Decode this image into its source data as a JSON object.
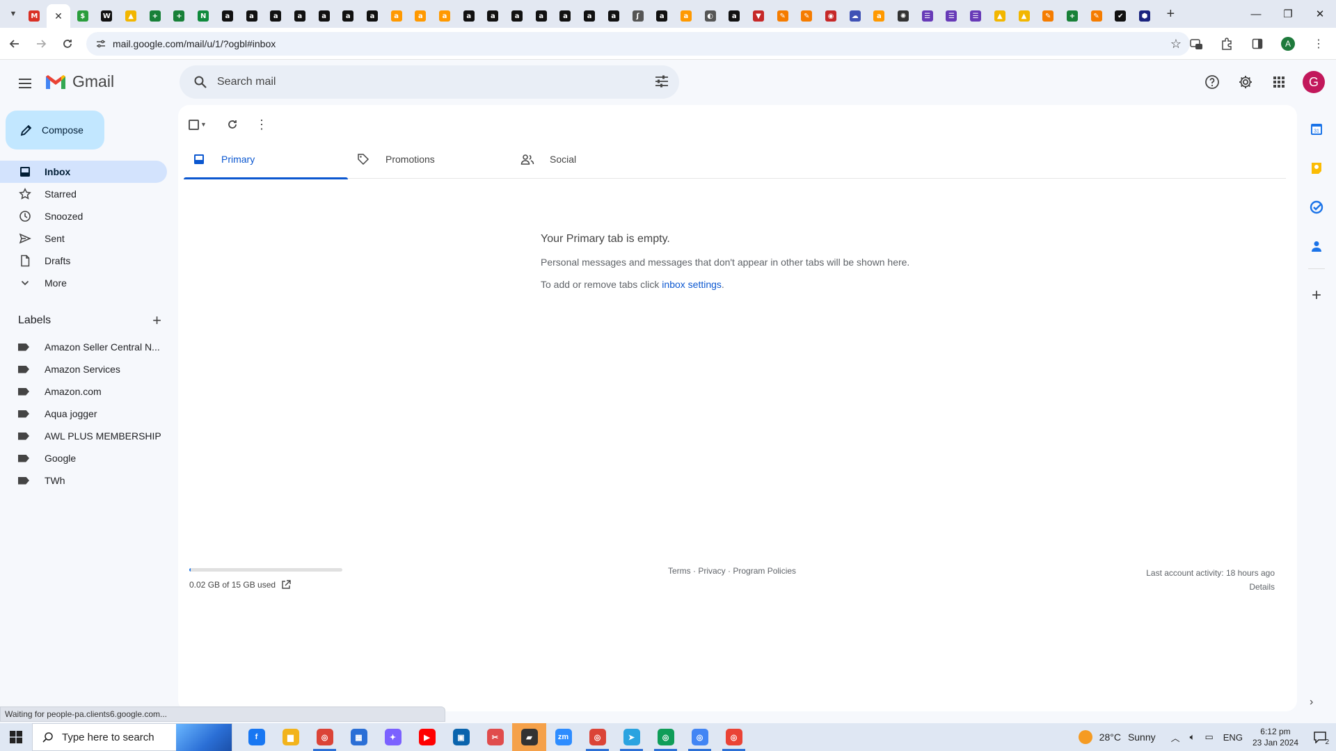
{
  "browser": {
    "tabs": [
      {
        "icon": "gmail-icon",
        "color": "#d93025",
        "glyph": "M"
      },
      {
        "icon": "close-icon",
        "color": "#333333",
        "glyph": "✕",
        "active": true
      },
      {
        "icon": "currency-icon",
        "color": "#2a9d3c",
        "glyph": "$"
      },
      {
        "icon": "wix-icon",
        "color": "#111111",
        "glyph": "W"
      },
      {
        "icon": "google-drive-icon",
        "color": "#f2b600",
        "glyph": "▲"
      },
      {
        "icon": "google-sheets-icon",
        "color": "#188038",
        "glyph": "+"
      },
      {
        "icon": "google-sheets-icon",
        "color": "#188038",
        "glyph": "+"
      },
      {
        "icon": "script-icon",
        "color": "#0f8a3c",
        "glyph": "N"
      },
      {
        "icon": "amazon-a-icon",
        "color": "#111111",
        "glyph": "a"
      },
      {
        "icon": "amazon-a-icon",
        "color": "#111111",
        "glyph": "a"
      },
      {
        "icon": "amazon-a-icon",
        "color": "#111111",
        "glyph": "a"
      },
      {
        "icon": "amazon-a-icon",
        "color": "#111111",
        "glyph": "a"
      },
      {
        "icon": "amazon-a-icon",
        "color": "#111111",
        "glyph": "a"
      },
      {
        "icon": "amazon-a-icon",
        "color": "#111111",
        "glyph": "a"
      },
      {
        "icon": "amazon-a-icon",
        "color": "#111111",
        "glyph": "a"
      },
      {
        "icon": "amazon-smile-icon",
        "color": "#ff9900",
        "glyph": "a"
      },
      {
        "icon": "amazon-smile-icon",
        "color": "#ff9900",
        "glyph": "a"
      },
      {
        "icon": "amazon-smile-icon",
        "color": "#ff9900",
        "glyph": "a"
      },
      {
        "icon": "amazon-a-icon",
        "color": "#111111",
        "glyph": "a"
      },
      {
        "icon": "amazon-a-icon",
        "color": "#111111",
        "glyph": "a"
      },
      {
        "icon": "amazon-a-icon",
        "color": "#111111",
        "glyph": "a"
      },
      {
        "icon": "amazon-a-icon",
        "color": "#111111",
        "glyph": "a"
      },
      {
        "icon": "amazon-a-icon",
        "color": "#111111",
        "glyph": "a"
      },
      {
        "icon": "amazon-a-icon",
        "color": "#111111",
        "glyph": "a"
      },
      {
        "icon": "amazon-a-icon",
        "color": "#111111",
        "glyph": "a"
      },
      {
        "icon": "hook-icon",
        "color": "#555555",
        "glyph": "ʃ"
      },
      {
        "icon": "amazon-a-icon",
        "color": "#111111",
        "glyph": "a"
      },
      {
        "icon": "amazon-smile-icon",
        "color": "#ff9900",
        "glyph": "a"
      },
      {
        "icon": "globe-icon",
        "color": "#555555",
        "glyph": "◐"
      },
      {
        "icon": "amazon-a-icon",
        "color": "#111111",
        "glyph": "a"
      },
      {
        "icon": "shield-icon",
        "color": "#c62828",
        "glyph": "▼"
      },
      {
        "icon": "pen-icon",
        "color": "#f57c00",
        "glyph": "✎"
      },
      {
        "icon": "pen-icon",
        "color": "#f57c00",
        "glyph": "✎"
      },
      {
        "icon": "circle-badge-icon",
        "color": "#c62828",
        "glyph": "◉"
      },
      {
        "icon": "cloud-icon",
        "color": "#3f51b5",
        "glyph": "☁"
      },
      {
        "icon": "amazon-smile-icon",
        "color": "#ff9900",
        "glyph": "a"
      },
      {
        "icon": "openai-icon",
        "color": "#333333",
        "glyph": "✺"
      },
      {
        "icon": "form-icon",
        "color": "#673ab7",
        "glyph": "☰"
      },
      {
        "icon": "form-icon",
        "color": "#673ab7",
        "glyph": "☰"
      },
      {
        "icon": "form-icon",
        "color": "#673ab7",
        "glyph": "☰"
      },
      {
        "icon": "google-drive-icon",
        "color": "#f2b600",
        "glyph": "▲"
      },
      {
        "icon": "google-drive-icon",
        "color": "#f2b600",
        "glyph": "▲"
      },
      {
        "icon": "pen-icon",
        "color": "#f57c00",
        "glyph": "✎"
      },
      {
        "icon": "google-sheets-icon",
        "color": "#188038",
        "glyph": "+"
      },
      {
        "icon": "pen-icon",
        "color": "#f57c00",
        "glyph": "✎"
      },
      {
        "icon": "checkmark-app-icon",
        "color": "#111111",
        "glyph": "✔"
      },
      {
        "icon": "hexagon-icon",
        "color": "#1a237e",
        "glyph": "⬢"
      }
    ],
    "url": "mail.google.com/mail/u/1/?ogbl#inbox",
    "profile_initial": "A"
  },
  "gmail": {
    "logo_text": "Gmail",
    "search_placeholder": "Search mail",
    "avatar_initial": "G",
    "compose_label": "Compose",
    "nav": [
      {
        "label": "Inbox",
        "icon": "inbox-icon",
        "active": true
      },
      {
        "label": "Starred",
        "icon": "star-icon"
      },
      {
        "label": "Snoozed",
        "icon": "clock-icon"
      },
      {
        "label": "Sent",
        "icon": "send-icon"
      },
      {
        "label": "Drafts",
        "icon": "draft-icon"
      },
      {
        "label": "More",
        "icon": "chevron-down-icon"
      }
    ],
    "labels_title": "Labels",
    "labels": [
      "Amazon Seller Central N...",
      "Amazon Services",
      "Amazon.com",
      "Aqua jogger",
      "AWL PLUS MEMBERSHIP",
      "Google",
      "TWh"
    ],
    "category_tabs": [
      {
        "label": "Primary",
        "icon": "inbox-tab-icon",
        "active": true
      },
      {
        "label": "Promotions",
        "icon": "tag-icon"
      },
      {
        "label": "Social",
        "icon": "people-icon"
      }
    ],
    "empty_state": {
      "title": "Your Primary tab is empty.",
      "line1": "Personal messages and messages that don't appear in other tabs will be shown here.",
      "line2_prefix": "To add or remove tabs click ",
      "line2_link": "inbox settings",
      "line2_suffix": "."
    },
    "storage": {
      "text": "0.02 GB of 15 GB used",
      "used_fraction": 0.0013
    },
    "footer": {
      "terms": "Terms",
      "privacy": "Privacy",
      "policies": "Program Policies",
      "separator": " · ",
      "activity": "Last account activity: 18 hours ago",
      "details": "Details"
    },
    "side_panel": [
      "calendar-icon",
      "keep-icon",
      "tasks-icon",
      "contacts-icon",
      "add-icon"
    ]
  },
  "status_text": "Waiting for people-pa.clients6.google.com...",
  "taskbar": {
    "search_placeholder": "Type here to search",
    "apps": [
      {
        "icon": "facebook-icon",
        "color": "#1877f2",
        "glyph": "f"
      },
      {
        "icon": "file-explorer-icon",
        "color": "#f2b31b",
        "glyph": "▆"
      },
      {
        "icon": "chrome-icon",
        "color": "#db4437",
        "glyph": "◎",
        "open": true
      },
      {
        "icon": "calculator-icon",
        "color": "#2b6fd6",
        "glyph": "▦"
      },
      {
        "icon": "copilot-icon",
        "color": "#7b61ff",
        "glyph": "✦"
      },
      {
        "icon": "youtube-icon",
        "color": "#ff0000",
        "glyph": "▶"
      },
      {
        "icon": "store-icon",
        "color": "#0a64ad",
        "glyph": "▣"
      },
      {
        "icon": "snipping-tool-icon",
        "color": "#e04c4c",
        "glyph": "✂"
      },
      {
        "icon": "sticky-notes-icon",
        "color": "#333333",
        "glyph": "▰",
        "highlight": true
      },
      {
        "icon": "zoom-icon",
        "color": "#2d8cff",
        "glyph": "zm"
      },
      {
        "icon": "chrome-profile-icon",
        "color": "#db4437",
        "glyph": "◎",
        "open": true
      },
      {
        "icon": "telegram-icon",
        "color": "#2aa3e0",
        "glyph": "➤",
        "open": true
      },
      {
        "icon": "chrome-profile-icon",
        "color": "#0f9d58",
        "glyph": "◎",
        "open": true
      },
      {
        "icon": "chrome-profile-icon",
        "color": "#4285f4",
        "glyph": "◎",
        "open": true
      },
      {
        "icon": "chrome-profile-icon",
        "color": "#ea4335",
        "glyph": "◎",
        "open": true
      }
    ],
    "weather_temp": "28°C",
    "weather_text": "Sunny",
    "language": "ENG",
    "time": "6:12 pm",
    "date": "23 Jan 2024",
    "notifications": "2"
  }
}
